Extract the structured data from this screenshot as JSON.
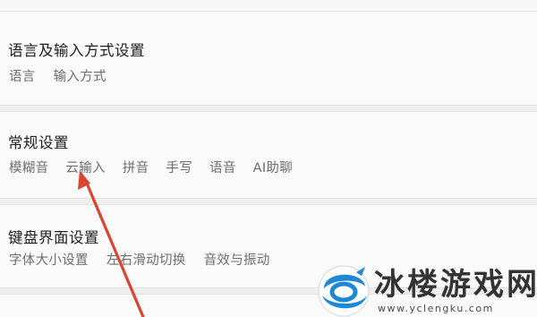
{
  "sections": [
    {
      "title": "语言及输入方式设置",
      "items": [
        "语言",
        "输入方式"
      ]
    },
    {
      "title": "常规设置",
      "items": [
        "模糊音",
        "云输入",
        "拼音",
        "手写",
        "语音",
        "AI助聊"
      ]
    },
    {
      "title": "键盘界面设置",
      "items": [
        "字体大小设置",
        "左右滑动切换",
        "音效与振动"
      ]
    }
  ],
  "watermark": {
    "name": "冰楼游戏网",
    "url": "www.yclengku.com"
  },
  "colors": {
    "annotation_arrow": "#d9452f",
    "watermark_blue": "#1e88d8"
  }
}
